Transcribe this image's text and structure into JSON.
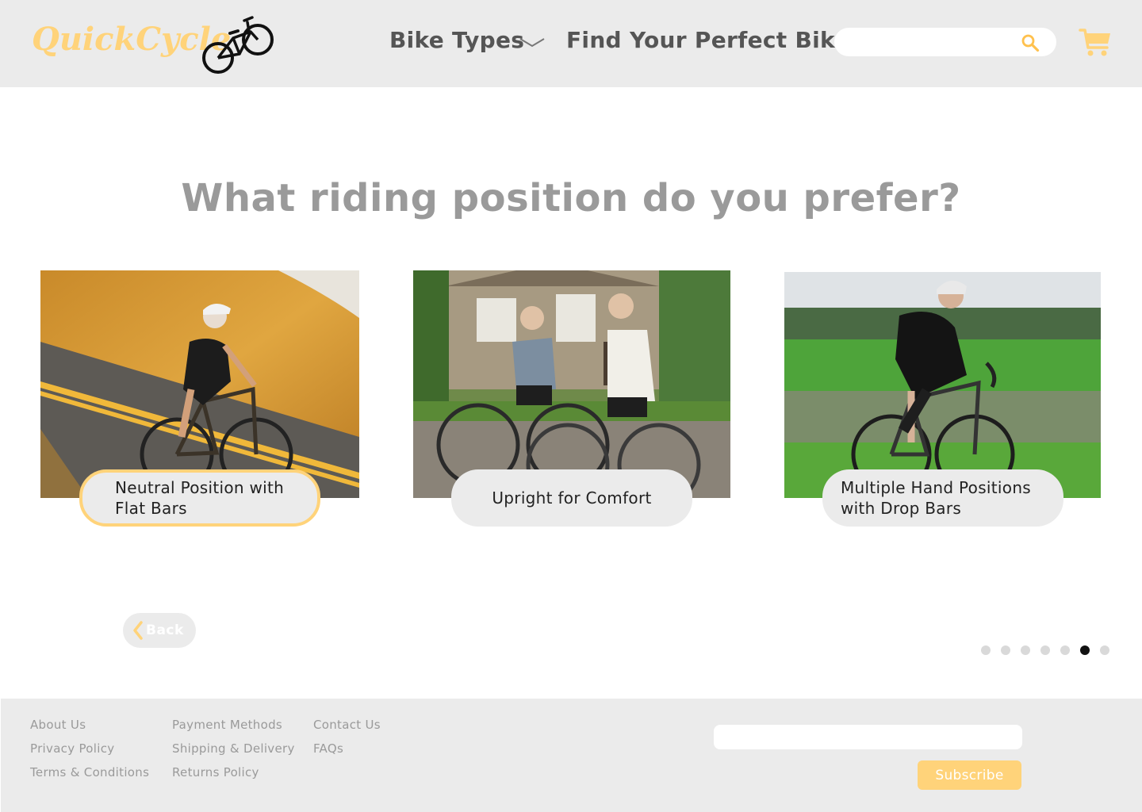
{
  "header": {
    "logo": "QuickCycle",
    "nav_bike_types": "Bike Types",
    "nav_find": "Find Your Perfect Bike",
    "search_placeholder": ""
  },
  "main": {
    "question": "What riding position do you prefer?",
    "options": [
      {
        "label": "Neutral Position with Flat Bars",
        "selected": true
      },
      {
        "label": "Upright for Comfort",
        "selected": false
      },
      {
        "label": "Multiple Hand Positions with Drop Bars",
        "selected": false
      }
    ],
    "back_label": "Back",
    "progress": {
      "total_steps": 7,
      "current_step": 6
    }
  },
  "footer": {
    "col1": [
      "About Us",
      "Privacy Policy",
      "Terms & Conditions"
    ],
    "col2": [
      "Payment Methods",
      "Shipping & Delivery",
      "Returns Policy"
    ],
    "col3": [
      "Contact Us",
      "FAQs"
    ],
    "subscribe_label": "Subscribe",
    "email_placeholder": ""
  },
  "colors": {
    "accent": "#ffd37a",
    "header_bg": "#ebebeb",
    "text_muted": "#9a9a9a"
  }
}
